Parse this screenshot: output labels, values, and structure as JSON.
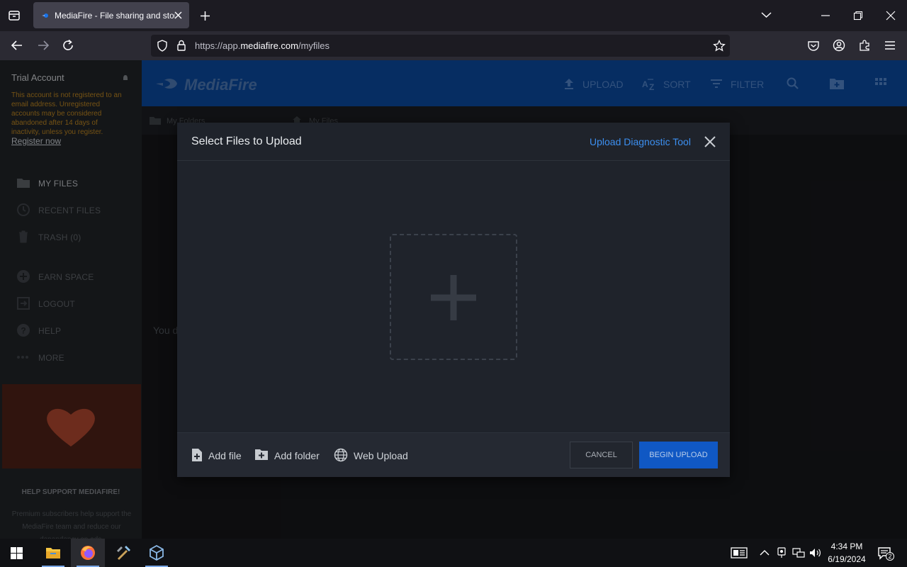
{
  "browser": {
    "tab_title": "MediaFire - File sharing and storage",
    "url_prefix": "https://app.",
    "url_domain": "mediafire.com",
    "url_path": "/myfiles"
  },
  "sidebar": {
    "trial_title": "Trial Account",
    "trial_note": "This account is not registered to an email address. Unregistered accounts may be considered abandoned after 14 days of inactivity, unless you register.",
    "register_link": "Register now",
    "items": [
      {
        "label": "MY FILES",
        "icon": "folder-icon"
      },
      {
        "label": "RECENT FILES",
        "icon": "clock-icon"
      },
      {
        "label": "TRASH (0)",
        "icon": "trash-icon"
      },
      {
        "label": "EARN SPACE",
        "icon": "plus-circle-icon"
      },
      {
        "label": "LOGOUT",
        "icon": "logout-icon"
      },
      {
        "label": "HELP",
        "icon": "help-icon"
      },
      {
        "label": "MORE",
        "icon": "more-icon"
      }
    ],
    "promo_title": "HELP SUPPORT MEDIAFIRE!",
    "promo_text": "Premium subscribers help support the MediaFire team and reduce our dependency on ads."
  },
  "header": {
    "logo_text": "MediaFire",
    "upload_label": "UPLOAD",
    "sort_label": "SORT",
    "filter_label": "FILTER"
  },
  "breadcrumbs": {
    "folders_label": "My Folders",
    "files_label": "My Files"
  },
  "main": {
    "empty_text": "You d"
  },
  "modal": {
    "title": "Select Files to Upload",
    "diagnostic_link": "Upload Diagnostic Tool",
    "add_file": "Add file",
    "add_folder": "Add folder",
    "web_upload": "Web Upload",
    "cancel": "CANCEL",
    "begin_upload": "BEGIN UPLOAD"
  },
  "taskbar": {
    "time": "4:34 PM",
    "date": "6/19/2024",
    "notification_count": "2"
  },
  "colors": {
    "accent": "#0a4597",
    "link": "#3c8ff0",
    "primary_button": "#1058c4",
    "warning_text": "#b6801f"
  }
}
